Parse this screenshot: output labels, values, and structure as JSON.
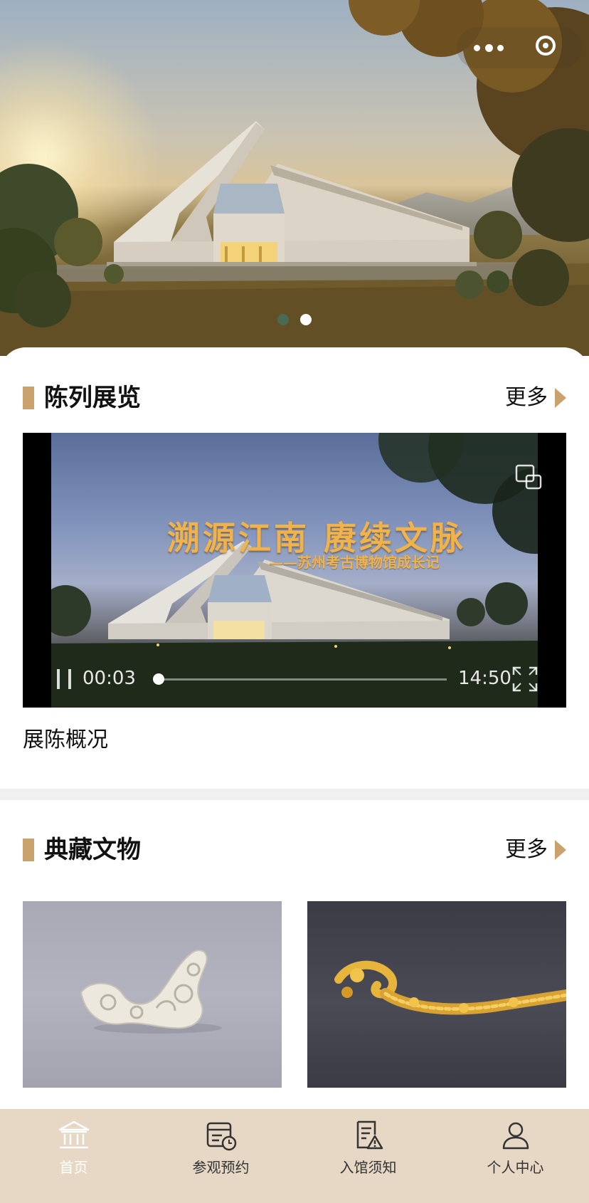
{
  "capsule": {
    "more_icon": "ellipsis-icon",
    "close_icon": "target-circle-icon"
  },
  "banner": {
    "slide_count": 2,
    "active_slide": 2
  },
  "exhibition": {
    "title": "陈列展览",
    "more_label": "更多",
    "video": {
      "title_line": "溯源江南   赓续文脉",
      "subtitle": "——苏州考古博物馆成长记",
      "current_time": "00:03",
      "total_time": "14:50",
      "progress_fraction": 0.0034,
      "state": "playing"
    },
    "caption": "展陈概况"
  },
  "collection": {
    "title": "典藏文物",
    "more_label": "更多",
    "items": [
      {
        "icon": "jade-ornament-image"
      },
      {
        "icon": "gold-dragon-image"
      }
    ]
  },
  "tabbar": {
    "active_color": "#ffffff",
    "background": "#e6d8c5",
    "accent": "#c9a26e",
    "tabs": [
      {
        "label": "首页",
        "icon": "museum-icon",
        "active": true
      },
      {
        "label": "参观预约",
        "icon": "calendar-clock-icon",
        "active": false
      },
      {
        "label": "入馆须知",
        "icon": "notice-warning-icon",
        "active": false
      },
      {
        "label": "个人中心",
        "icon": "user-icon",
        "active": false
      }
    ]
  }
}
